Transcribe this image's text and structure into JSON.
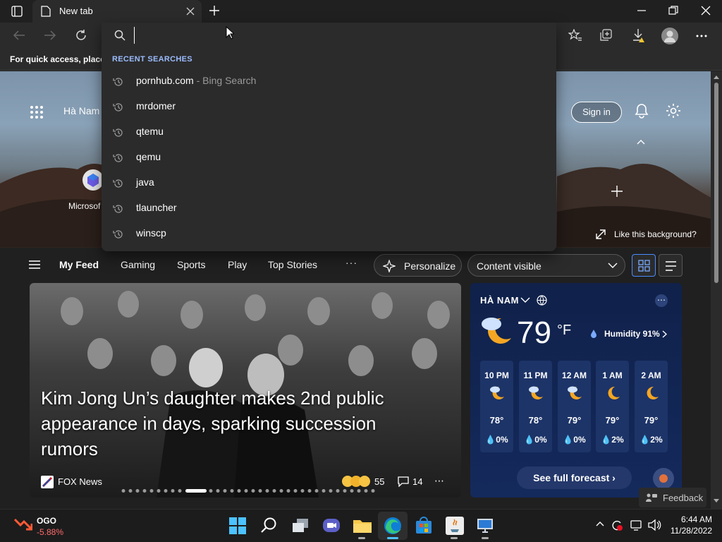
{
  "browser": {
    "tab_title": "New tab",
    "favorites_hint": "For quick access, place y"
  },
  "omnibox": {
    "value": "",
    "recent_header": "RECENT SEARCHES",
    "recent": [
      {
        "text": "pornhub.com",
        "suffix": " - Bing Search"
      },
      {
        "text": "mrdomer",
        "suffix": ""
      },
      {
        "text": "qtemu",
        "suffix": ""
      },
      {
        "text": "qemu",
        "suffix": ""
      },
      {
        "text": "java",
        "suffix": ""
      },
      {
        "text": "tlauncher",
        "suffix": ""
      },
      {
        "text": "winscp",
        "suffix": ""
      }
    ]
  },
  "newtab": {
    "location": "Hà Nam",
    "quicklink_label": "Microsof",
    "sign_in": "Sign in",
    "like_background": "Like this background?"
  },
  "feed_nav": {
    "items": [
      "My Feed",
      "Gaming",
      "Sports",
      "Play",
      "Top Stories"
    ],
    "more": "···",
    "personalize": "Personalize",
    "content_select": "Content visible"
  },
  "hero": {
    "headline": "Kim Jong Un’s daughter makes 2nd public appearance in days, sparking succession rumors",
    "source": "FOX News",
    "reactions": "55",
    "comments": "14"
  },
  "weather": {
    "location": "HÀ NAM",
    "temp": "79",
    "unit": "°F",
    "humidity": "Humidity 91%",
    "hours": [
      {
        "time": "10 PM",
        "temp": "78°",
        "precip": "0%"
      },
      {
        "time": "11 PM",
        "temp": "78°",
        "precip": "0%"
      },
      {
        "time": "12 AM",
        "temp": "79°",
        "precip": "0%"
      },
      {
        "time": "1 AM",
        "temp": "79°",
        "precip": "2%"
      },
      {
        "time": "2 AM",
        "temp": "79°",
        "precip": "2%"
      }
    ],
    "forecast_button": "See full forecast"
  },
  "feedback": "Feedback",
  "taskbar": {
    "stock_name": "OGO",
    "stock_change": "-5.88%",
    "time": "6:44 AM",
    "date": "11/28/2022"
  },
  "colors": {
    "accent_blue": "#9bbcff",
    "stock_red": "#ff6b6b",
    "weather_card": "#142a5c"
  }
}
